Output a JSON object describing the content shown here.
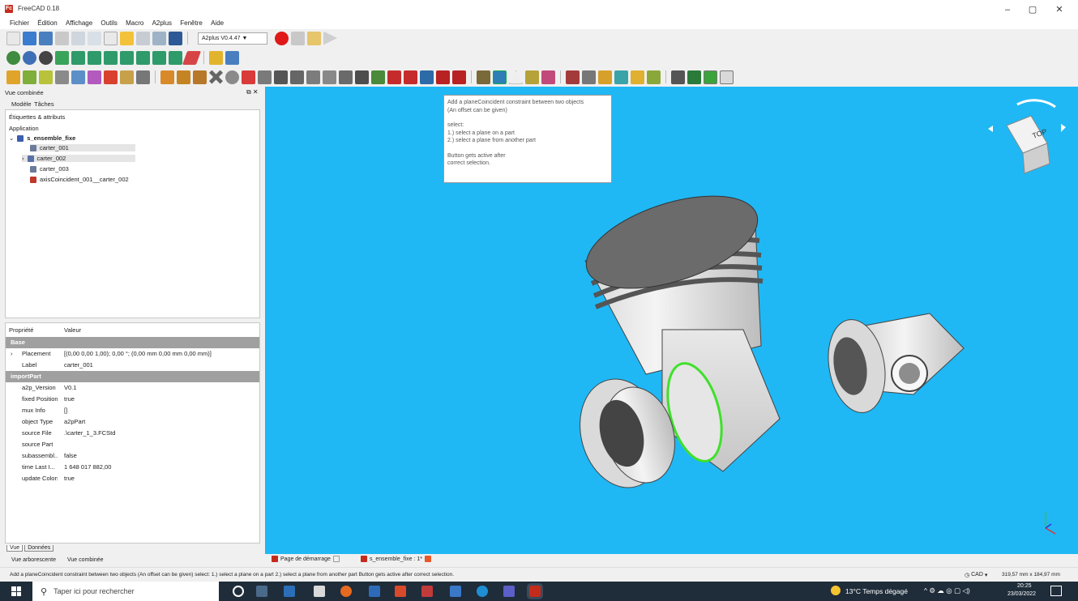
{
  "window": {
    "title": "FreeCAD 0.18",
    "logo_text": "Fc",
    "minimize": "–",
    "maximize": "▢",
    "close": "✕"
  },
  "menu": [
    "Fichier",
    "Édition",
    "Affichage",
    "Outils",
    "Macro",
    "A2plus",
    "Fenêtre",
    "Aide"
  ],
  "toolbar": {
    "workbench": "A2plus V0.4.47",
    "workbench_arrow": "▼"
  },
  "combo_view": {
    "title": "Vue combinée",
    "tabs": [
      "Modèle",
      "Tâches"
    ],
    "labels_header": "Étiquettes & attributs",
    "application": "Application",
    "tree": [
      {
        "label": "s_ensemble_fixe",
        "level": 0,
        "expander": "⌄",
        "color": "#3a5fb0",
        "bold": true
      },
      {
        "label": "carter_001",
        "level": 1,
        "color": "#6a7a9a",
        "selected": true
      },
      {
        "label": "carter_002",
        "level": 1,
        "color": "#5a70a8",
        "expander": "›"
      },
      {
        "label": "carter_003",
        "level": 1,
        "color": "#6a7a9a"
      },
      {
        "label": "axisCoincident_001__carter_002",
        "level": 1,
        "color": "#c0392b"
      }
    ],
    "properties_header": {
      "name": "Propriété",
      "value": "Valeur"
    },
    "properties": [
      {
        "group": "Base"
      },
      {
        "name": "Placement",
        "value": "[(0,00 0,00 1,00); 0,00 °; (0,00 mm  0,00 mm  0,00 mm)]",
        "expander": "›"
      },
      {
        "name": "Label",
        "value": "carter_001"
      },
      {
        "group": "importPart"
      },
      {
        "name": "a2p_Version",
        "value": "V0.1"
      },
      {
        "name": "fixed Position",
        "value": "true"
      },
      {
        "name": "mux Info",
        "value": "[]"
      },
      {
        "name": "object Type",
        "value": "a2pPart"
      },
      {
        "name": "source File",
        "value": ".\\carter_1_3.FCStd"
      },
      {
        "name": "source Part",
        "value": ""
      },
      {
        "name": "subassembl...",
        "value": "false"
      },
      {
        "name": "time Last I...",
        "value": "1 648 017 882,00"
      },
      {
        "name": "update Colors",
        "value": "true"
      }
    ],
    "bottom_tabs": [
      "Vue",
      "Données"
    ],
    "view_tabs": [
      "Vue arborescente",
      "Vue combinée"
    ]
  },
  "tooltip": {
    "line1": "Add a planeCoincident constraint between two objects",
    "line2": "(An offset can be given)",
    "line3": "select:",
    "line4": "1.) select a plane on a part",
    "line5": "2.) select a plane from another part",
    "line6": "Button gets active after",
    "line7": "correct selection."
  },
  "navcube": {
    "face": "TOP"
  },
  "doc_tabs": [
    {
      "label": "Page de démarrage",
      "active": false
    },
    {
      "label": "s_ensemble_fixe : 1*",
      "active": true
    }
  ],
  "status": {
    "message": "Add a planeCoincident constraint between two objects (An offset can be given)  select: 1.) select a plane on a part 2.) select a plane from another part  Button gets active after correct selection.",
    "nav_style": "CAD",
    "nav_arrow": "▾",
    "dimensions": "319,57 mm x 184,97 mm"
  },
  "taskbar": {
    "search_placeholder": "Taper ici pour rechercher",
    "weather": "13°C  Temps dégagé",
    "time": "20:25",
    "date": "23/03/2022",
    "tray": "^  ⚙  ☁  ◎  ▢  ◁)"
  },
  "colors": {
    "viewport": "#1fb8f5",
    "selection_edge": "#3fe02a",
    "part_light": "#ededed",
    "part_dark": "#6b6b6b"
  }
}
